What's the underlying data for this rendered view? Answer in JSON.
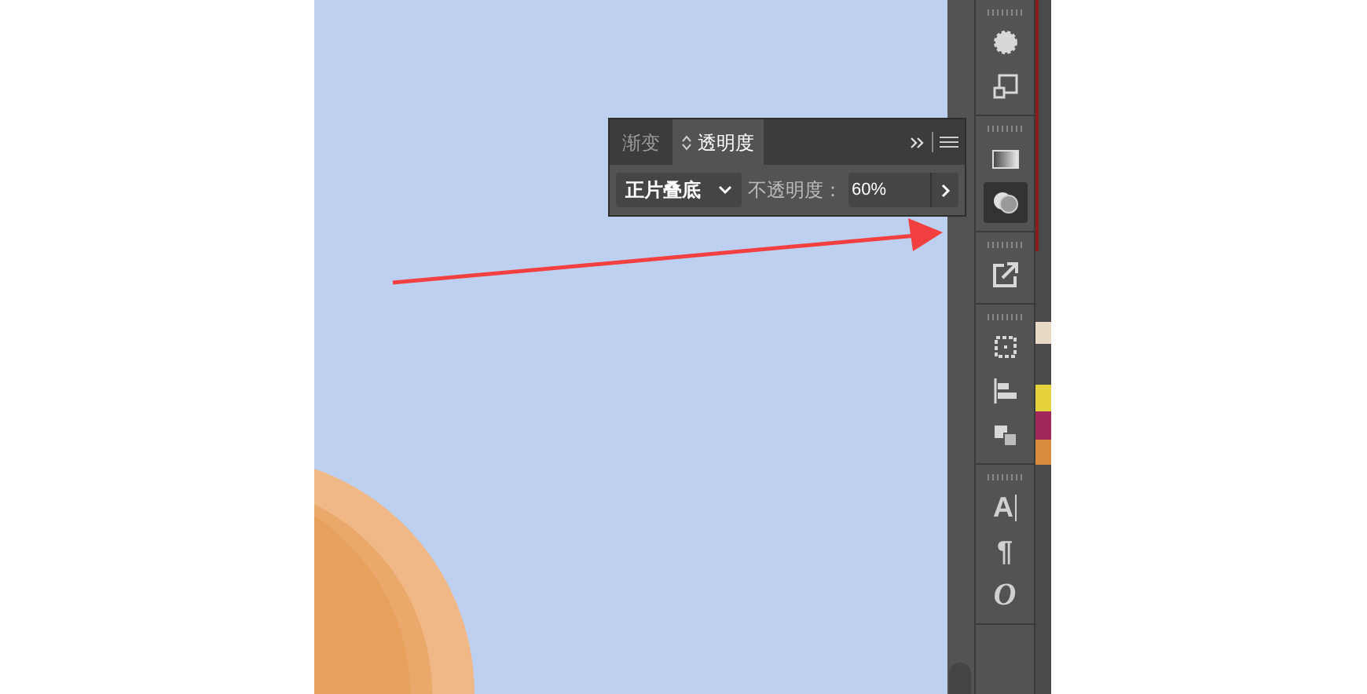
{
  "panel": {
    "tabs": [
      {
        "label": "渐变",
        "selected": false
      },
      {
        "label": "透明度",
        "selected": true
      }
    ],
    "blend_mode": "正片叠底",
    "opacity_label": "不透明度：",
    "opacity_value": "60%"
  },
  "toolbar": {
    "groups": [
      [
        {
          "kind": "appearance",
          "selected": false
        },
        {
          "kind": "transform",
          "selected": false
        }
      ],
      [
        {
          "kind": "gradient",
          "selected": false
        },
        {
          "kind": "transparency",
          "selected": true
        }
      ],
      [
        {
          "kind": "export",
          "selected": false
        }
      ],
      [
        {
          "kind": "artboard",
          "selected": false
        },
        {
          "kind": "align",
          "selected": false
        },
        {
          "kind": "pathfinder",
          "selected": false
        }
      ],
      [
        {
          "kind": "character",
          "selected": false,
          "glyph": "A"
        },
        {
          "kind": "paragraph",
          "selected": false,
          "glyph": "¶"
        },
        {
          "kind": "opentype",
          "selected": false,
          "glyph": "O"
        }
      ]
    ]
  }
}
